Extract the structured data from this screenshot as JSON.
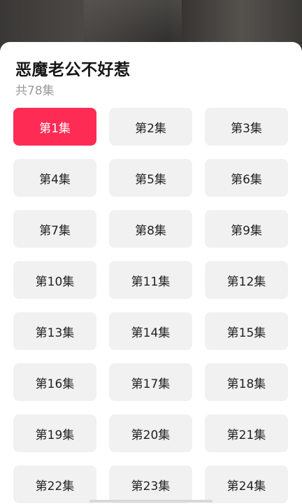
{
  "drama": {
    "title": "恶魔老公不好惹",
    "episode_count": "共78集"
  },
  "episodes": [
    {
      "label": "第1集",
      "selected": true
    },
    {
      "label": "第2集"
    },
    {
      "label": "第3集"
    },
    {
      "label": "第4集"
    },
    {
      "label": "第5集"
    },
    {
      "label": "第6集"
    },
    {
      "label": "第7集"
    },
    {
      "label": "第8集"
    },
    {
      "label": "第9集"
    },
    {
      "label": "第10集"
    },
    {
      "label": "第11集"
    },
    {
      "label": "第12集"
    },
    {
      "label": "第13集"
    },
    {
      "label": "第14集"
    },
    {
      "label": "第15集"
    },
    {
      "label": "第16集"
    },
    {
      "label": "第17集"
    },
    {
      "label": "第18集"
    },
    {
      "label": "第19集"
    },
    {
      "label": "第20集"
    },
    {
      "label": "第21集"
    },
    {
      "label": "第22集"
    },
    {
      "label": "第23集"
    },
    {
      "label": "第24集"
    }
  ],
  "colors": {
    "selected_episode": "#fe2c55",
    "episode_bg": "#f1f1f1"
  }
}
